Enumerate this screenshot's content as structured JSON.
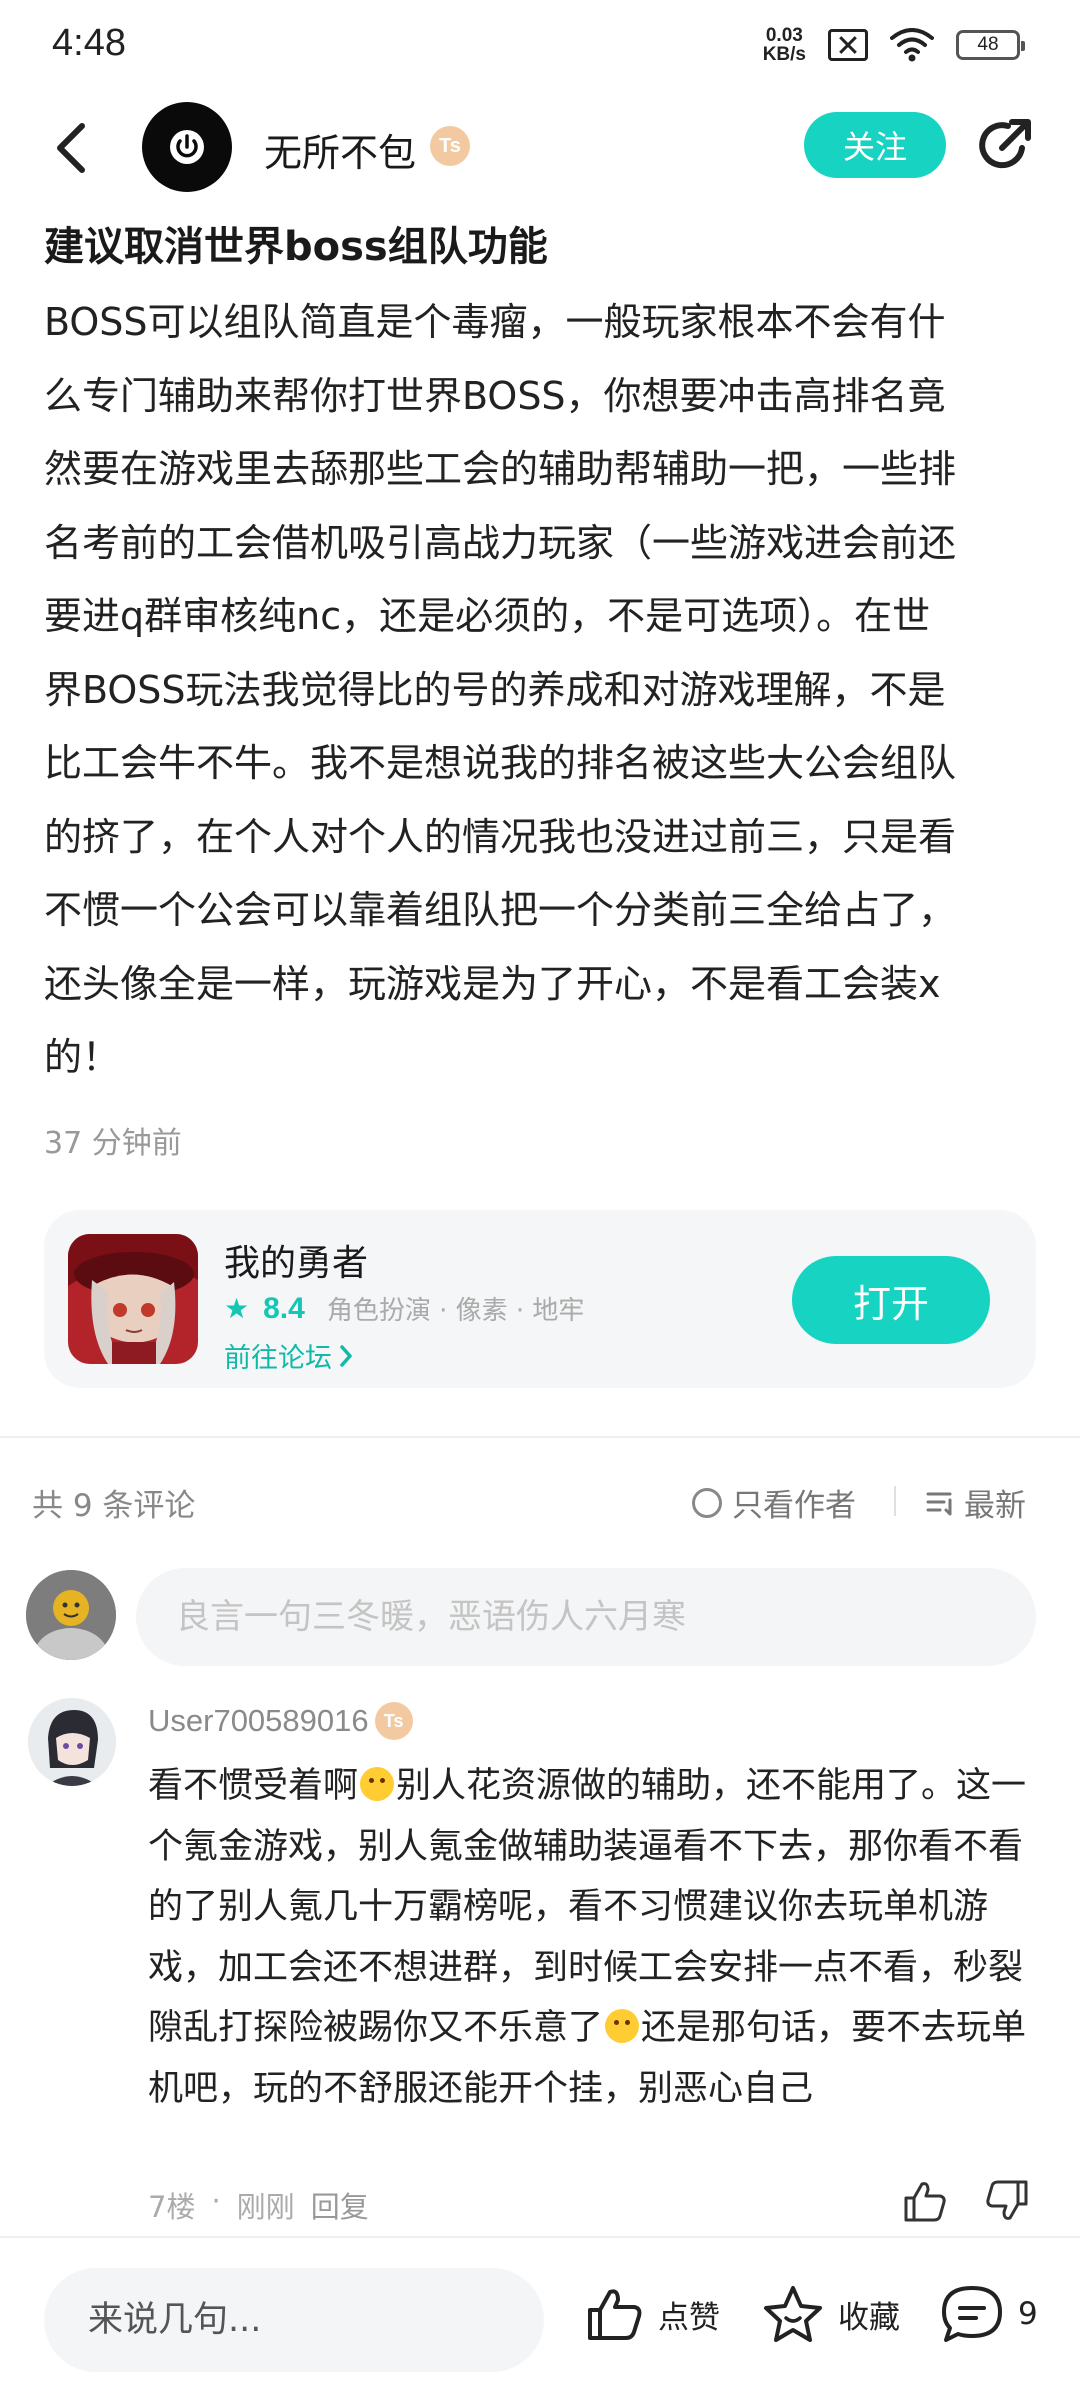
{
  "status_bar": {
    "time": "4:48",
    "net_speed_value": "0.03",
    "net_speed_unit": "KB/s",
    "battery": "48"
  },
  "header": {
    "author_name": "无所不包",
    "level_badge": "Ts",
    "follow_label": "关注"
  },
  "post": {
    "title": "建议取消世界boss组队功能",
    "body": "BOSS可以组队简直是个毒瘤，一般玩家根本不会有什\n么专门辅助来帮你打世界BOSS，你想要冲击高排名竟\n然要在游戏里去舔那些工会的辅助帮辅助一把，一些排\n名考前的工会借机吸引高战力玩家（一些游戏进会前还\n要进q群审核纯nc，还是必须的，不是可选项）。在世\n界BOSS玩法我觉得比的号的养成和对游戏理解，不是\n比工会牛不牛。我不是想说我的排名被这些大公会组队\n的挤了，在个人对个人的情况我也没进过前三，只是看\n不惯一个公会可以靠着组队把一个分类前三全给占了，\n还头像全是一样，玩游戏是为了开心，不是看工会装x\n的！",
    "time_ago": "37 分钟前"
  },
  "game_card": {
    "name": "我的勇者",
    "score": "8.4",
    "tags": "角色扮演 · 像素 · 地牢",
    "forum_link": "前往论坛",
    "open_label": "打开"
  },
  "comments_header": {
    "count_label": "共 9 条评论",
    "only_author_label": "只看作者",
    "sort_label": "最新"
  },
  "comment_input": {
    "placeholder": "良言一句三冬暖，恶语伤人六月寒"
  },
  "comment": {
    "user": "User700589016",
    "level_badge": "Ts",
    "text_part1": "看不惯受着啊",
    "text_part2": "别人花资源做的辅助，还不能用了。这一个氪金游戏，别人氪金做辅助装逼看不下去，那你看不看的了别人氪几十万霸榜呢，看不习惯建议你去玩单机游戏，加工会还不想进群，到时候工会安排一点不看，秒裂隙乱打探险被踢你又不乐意了",
    "text_part3": "还是那句话，要不去玩单机吧，玩的不舒服还能开个挂，别恶心自己",
    "floor": "7楼",
    "time": "刚刚",
    "reply_label": "回复"
  },
  "bottom_bar": {
    "input_placeholder": "来说几句...",
    "like_label": "点赞",
    "favorite_label": "收藏",
    "comment_count": "9"
  },
  "colors": {
    "accent": "#17d3c1",
    "accent_dark": "#12b9a9",
    "level_badge": "#f3c9a2"
  }
}
